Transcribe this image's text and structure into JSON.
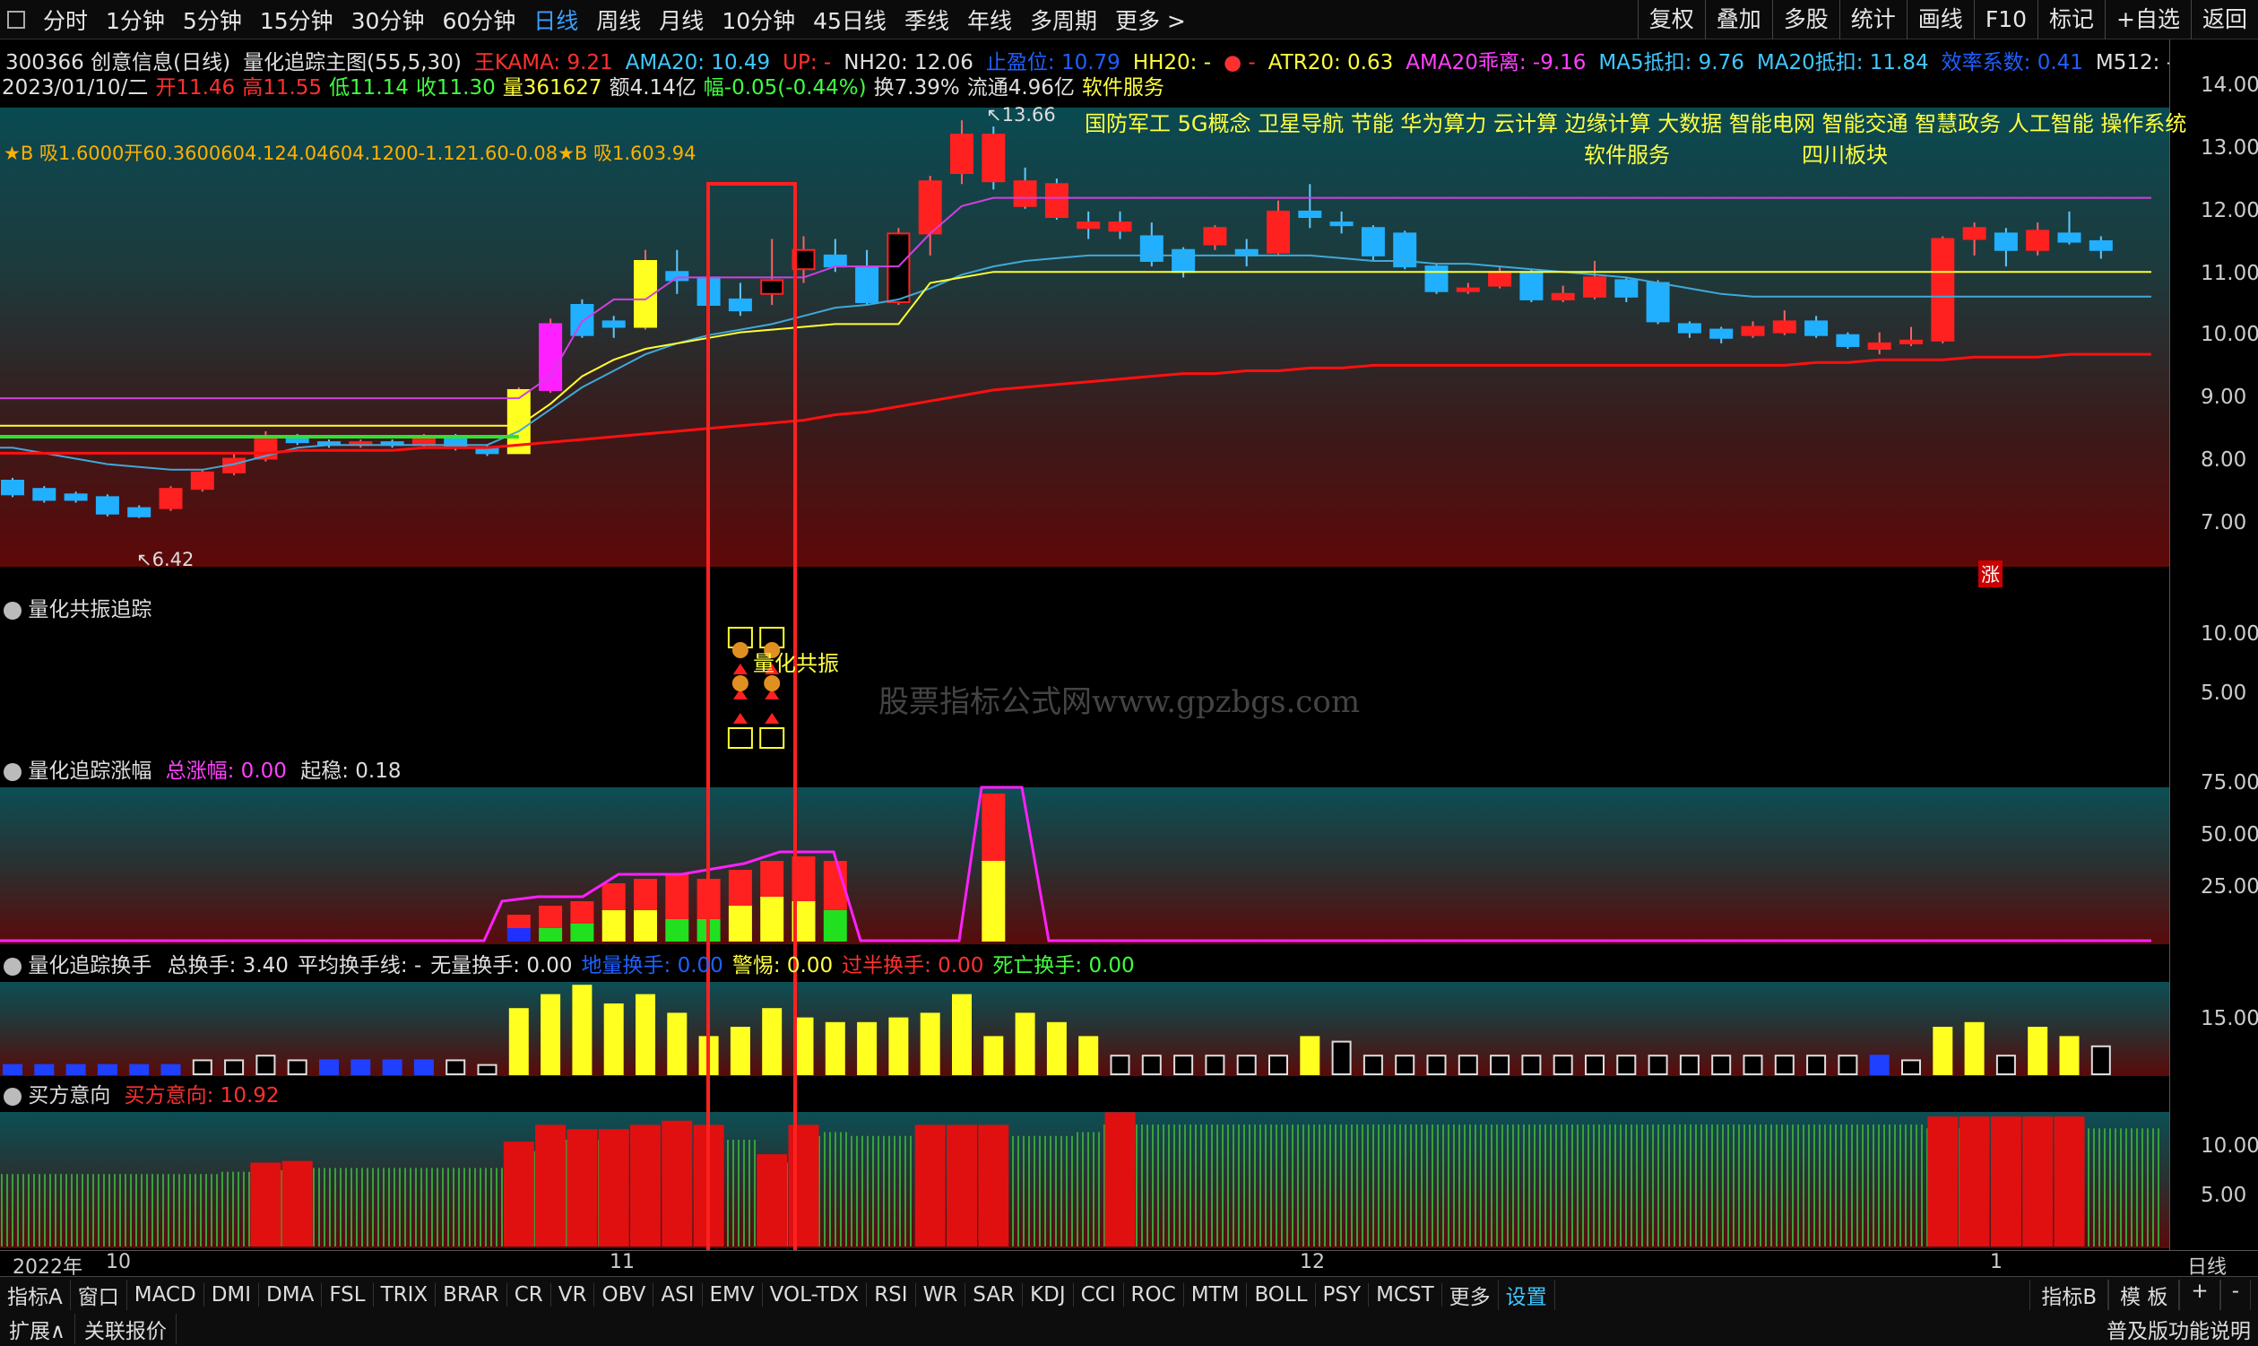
{
  "topbar": {
    "timeframes": [
      "分时",
      "1分钟",
      "5分钟",
      "15分钟",
      "30分钟",
      "60分钟",
      "日线",
      "周线",
      "月线",
      "10分钟",
      "45日线",
      "季线",
      "年线",
      "多周期",
      "更多 >"
    ],
    "active": "日线",
    "right": [
      "复权",
      "叠加",
      "多股",
      "统计",
      "画线",
      "F10",
      "标记",
      "+自选",
      "返回"
    ]
  },
  "info1": [
    {
      "t": "300366 创意信息(日线)",
      "c": "#e0e0e0"
    },
    {
      "t": "量化追踪主图(55,5,30)",
      "c": "#e0e0e0"
    },
    {
      "t": "王KAMA: 9.21",
      "c": "#ff3030"
    },
    {
      "t": "AMA20: 10.49",
      "c": "#40c8ff"
    },
    {
      "t": "UP: -",
      "c": "#ff3030"
    },
    {
      "t": "NH20: 12.06",
      "c": "#e0e0e0"
    },
    {
      "t": "止盈位: 10.79",
      "c": "#2060ff"
    },
    {
      "t": "HH20: -",
      "c": "#ffff40"
    },
    {
      "t": "● -",
      "c": "#ff3030"
    },
    {
      "t": "ATR20: 0.63",
      "c": "#ffff40"
    },
    {
      "t": "AMA20乖离: -9.16",
      "c": "#ff40ff"
    },
    {
      "t": "MA5抵扣: 9.76",
      "c": "#40c8ff"
    },
    {
      "t": "MA20抵扣: 11.84",
      "c": "#40c8ff"
    },
    {
      "t": "效率系数: 0.41",
      "c": "#2060ff"
    },
    {
      "t": "M512: -",
      "c": "#e0e0e0"
    },
    {
      "t": "M",
      "c": "#2060ff"
    }
  ],
  "info2": [
    {
      "t": "2023/01/10/二",
      "c": "#e0e0e0"
    },
    {
      "t": "开11.46",
      "c": "#ff3030"
    },
    {
      "t": "高11.55",
      "c": "#ff3030"
    },
    {
      "t": "低11.14",
      "c": "#40ff40"
    },
    {
      "t": "收11.30",
      "c": "#40ff40"
    },
    {
      "t": "量361627",
      "c": "#ffff40"
    },
    {
      "t": "额4.14亿",
      "c": "#e0e0e0"
    },
    {
      "t": "幅-0.05(-0.44%)",
      "c": "#40ff40"
    },
    {
      "t": "换7.39%",
      "c": "#e0e0e0"
    },
    {
      "t": "流通4.96亿",
      "c": "#e0e0e0"
    },
    {
      "t": "软件服务",
      "c": "#ffff40"
    }
  ],
  "main": {
    "annotation": "★B 吸1.6000开60.3600604.124.04604.1200-1.121.60-0.08★B 吸1.603.94",
    "concepts_line1": "国防军工 5G概念 卫星导航 节能 华为算力 云计算 边缘计算 大数据 智能电网 智能交通 智慧政务 人工智能 操作系统",
    "concepts_line2a": "软件服务",
    "concepts_line2b": "四川板块",
    "low_label": "6.42",
    "high_label": "13.66",
    "zhang": "涨"
  },
  "yaxis": {
    "main": [
      "14.00",
      "13.00",
      "12.00",
      "11.00",
      "10.00",
      "9.00",
      "8.00",
      "7.00"
    ],
    "p1": [
      "10.00",
      "5.00"
    ],
    "p2": [
      "75.00",
      "50.00",
      "25.00"
    ],
    "p3": [
      "15.00"
    ],
    "p4": [
      "10.00",
      "5.00"
    ]
  },
  "pane1": {
    "title": "量化共振追踪",
    "label": "量化共振",
    "watermark": "股票指标公式网www.gpzbgs.com"
  },
  "pane2": {
    "title": "量化追踪涨幅",
    "total": "总涨幅: 0.00",
    "start": "起稳: 0.18"
  },
  "pane3": {
    "title": "量化追踪换手",
    "items": [
      {
        "t": "总换手: 3.40",
        "c": "#e0e0e0"
      },
      {
        "t": "平均换手线: -",
        "c": "#e0e0e0"
      },
      {
        "t": "无量换手: 0.00",
        "c": "#e0e0e0"
      },
      {
        "t": "地量换手: 0.00",
        "c": "#2060ff"
      },
      {
        "t": "警惕: 0.00",
        "c": "#ffff40"
      },
      {
        "t": "过半换手: 0.00",
        "c": "#ff3030"
      },
      {
        "t": "死亡换手: 0.00",
        "c": "#40ff40"
      }
    ]
  },
  "pane4": {
    "title": "买方意向",
    "value": "买方意向: 10.92"
  },
  "xaxis": {
    "labels": [
      "2022年",
      "10",
      "11",
      "12",
      "1"
    ],
    "right": "日线"
  },
  "bottom1": [
    "指标A",
    "窗口",
    "MACD",
    "DMI",
    "DMA",
    "FSL",
    "TRIX",
    "BRAR",
    "CR",
    "VR",
    "OBV",
    "ASI",
    "EMV",
    "VOL-TDX",
    "RSI",
    "WR",
    "SAR",
    "KDJ",
    "CCI",
    "ROC",
    "MTM",
    "BOLL",
    "PSY",
    "MCST",
    "更多",
    "设置"
  ],
  "bottom1_right": [
    "指标B",
    "模 板",
    "+",
    "-"
  ],
  "bottom2": [
    "扩展∧",
    "关联报价"
  ],
  "bottom2_right": "普及版功能说明",
  "chart_data": {
    "type": "candlestick",
    "yrange": [
      6.3,
      14.3
    ],
    "candles": [
      {
        "o": 7.1,
        "c": 6.85,
        "h": 7.15,
        "l": 6.8
      },
      {
        "o": 6.95,
        "c": 6.75,
        "h": 7.0,
        "l": 6.7
      },
      {
        "o": 6.85,
        "c": 6.75,
        "h": 6.9,
        "l": 6.7
      },
      {
        "o": 6.8,
        "c": 6.5,
        "h": 6.85,
        "l": 6.45
      },
      {
        "o": 6.6,
        "c": 6.45,
        "h": 6.65,
        "l": 6.42
      },
      {
        "o": 6.6,
        "c": 6.95,
        "h": 7.0,
        "l": 6.55
      },
      {
        "o": 6.95,
        "c": 7.25,
        "h": 7.3,
        "l": 6.9
      },
      {
        "o": 7.25,
        "c": 7.5,
        "h": 7.6,
        "l": 7.2
      },
      {
        "o": 7.5,
        "c": 7.9,
        "h": 8.0,
        "l": 7.45
      },
      {
        "o": 7.9,
        "c": 7.8,
        "h": 7.95,
        "l": 7.75
      },
      {
        "o": 7.8,
        "c": 7.75,
        "h": 7.85,
        "l": 7.7
      },
      {
        "o": 7.75,
        "c": 7.8,
        "h": 7.85,
        "l": 7.7
      },
      {
        "o": 7.8,
        "c": 7.75,
        "h": 7.85,
        "l": 7.7
      },
      {
        "o": 7.75,
        "c": 7.9,
        "h": 7.95,
        "l": 7.7
      },
      {
        "o": 7.9,
        "c": 7.7,
        "h": 7.95,
        "l": 7.65
      },
      {
        "o": 7.7,
        "c": 7.6,
        "h": 7.75,
        "l": 7.55
      },
      {
        "o": 7.6,
        "c": 8.75,
        "h": 8.8,
        "l": 7.6
      },
      {
        "o": 8.75,
        "c": 9.95,
        "h": 10.05,
        "l": 8.7
      },
      {
        "o": 10.3,
        "c": 9.75,
        "h": 10.4,
        "l": 9.7
      },
      {
        "o": 10.0,
        "c": 9.9,
        "h": 10.1,
        "l": 9.7
      },
      {
        "o": 9.9,
        "c": 11.1,
        "h": 11.3,
        "l": 9.85
      },
      {
        "o": 10.9,
        "c": 10.75,
        "h": 11.3,
        "l": 10.5
      },
      {
        "o": 10.8,
        "c": 10.3,
        "h": 11.0,
        "l": 10.2
      },
      {
        "o": 10.4,
        "c": 10.2,
        "h": 10.7,
        "l": 10.1
      },
      {
        "o": 10.5,
        "c": 10.75,
        "h": 11.5,
        "l": 10.3
      },
      {
        "o": 10.95,
        "c": 11.3,
        "h": 11.55,
        "l": 10.7
      },
      {
        "o": 11.2,
        "c": 11.0,
        "h": 11.5,
        "l": 10.9
      },
      {
        "o": 11.0,
        "c": 10.35,
        "h": 11.3,
        "l": 10.3
      },
      {
        "o": 10.35,
        "c": 11.6,
        "h": 11.7,
        "l": 10.3
      },
      {
        "o": 11.6,
        "c": 12.55,
        "h": 12.65,
        "l": 11.2
      },
      {
        "o": 12.7,
        "c": 13.4,
        "h": 13.66,
        "l": 12.5
      },
      {
        "o": 13.4,
        "c": 12.55,
        "h": 13.55,
        "l": 12.4
      },
      {
        "o": 12.55,
        "c": 12.1,
        "h": 12.8,
        "l": 12.05
      },
      {
        "o": 12.5,
        "c": 11.9,
        "h": 12.6,
        "l": 11.85
      },
      {
        "o": 11.8,
        "c": 11.7,
        "h": 12.0,
        "l": 11.5
      },
      {
        "o": 11.8,
        "c": 11.65,
        "h": 12.0,
        "l": 11.5
      },
      {
        "o": 11.55,
        "c": 11.1,
        "h": 11.8,
        "l": 11.0
      },
      {
        "o": 11.3,
        "c": 10.9,
        "h": 11.35,
        "l": 10.8
      },
      {
        "o": 11.4,
        "c": 11.7,
        "h": 11.75,
        "l": 11.3
      },
      {
        "o": 11.3,
        "c": 11.2,
        "h": 11.5,
        "l": 11.0
      },
      {
        "o": 11.25,
        "c": 12.0,
        "h": 12.2,
        "l": 11.2
      },
      {
        "o": 12.0,
        "c": 11.9,
        "h": 12.5,
        "l": 11.7
      },
      {
        "o": 11.8,
        "c": 11.75,
        "h": 12.0,
        "l": 11.6
      },
      {
        "o": 11.7,
        "c": 11.2,
        "h": 11.75,
        "l": 11.1
      },
      {
        "o": 11.6,
        "c": 11.0,
        "h": 11.65,
        "l": 10.95
      },
      {
        "o": 11.0,
        "c": 10.55,
        "h": 11.05,
        "l": 10.5
      },
      {
        "o": 10.55,
        "c": 10.6,
        "h": 10.7,
        "l": 10.5
      },
      {
        "o": 10.65,
        "c": 10.9,
        "h": 11.0,
        "l": 10.6
      },
      {
        "o": 10.9,
        "c": 10.4,
        "h": 10.95,
        "l": 10.35
      },
      {
        "o": 10.4,
        "c": 10.5,
        "h": 10.65,
        "l": 10.35
      },
      {
        "o": 10.45,
        "c": 10.8,
        "h": 11.1,
        "l": 10.4
      },
      {
        "o": 10.75,
        "c": 10.45,
        "h": 10.8,
        "l": 10.35
      },
      {
        "o": 10.7,
        "c": 10.0,
        "h": 10.75,
        "l": 9.95
      },
      {
        "o": 9.95,
        "c": 9.8,
        "h": 10.0,
        "l": 9.7
      },
      {
        "o": 9.85,
        "c": 9.7,
        "h": 9.9,
        "l": 9.6
      },
      {
        "o": 9.75,
        "c": 9.9,
        "h": 10.0,
        "l": 9.7
      },
      {
        "o": 9.8,
        "c": 10.0,
        "h": 10.2,
        "l": 9.75
      },
      {
        "o": 10.0,
        "c": 9.75,
        "h": 10.1,
        "l": 9.7
      },
      {
        "o": 9.75,
        "c": 9.55,
        "h": 9.8,
        "l": 9.5
      },
      {
        "o": 9.5,
        "c": 9.6,
        "h": 9.8,
        "l": 9.4
      },
      {
        "o": 9.6,
        "c": 9.65,
        "h": 9.9,
        "l": 9.55
      },
      {
        "o": 9.65,
        "c": 11.5,
        "h": 11.55,
        "l": 9.6
      },
      {
        "o": 11.5,
        "c": 11.7,
        "h": 11.8,
        "l": 11.2
      },
      {
        "o": 11.6,
        "c": 11.3,
        "h": 11.7,
        "l": 11.0
      },
      {
        "o": 11.3,
        "c": 11.65,
        "h": 11.8,
        "l": 11.2
      },
      {
        "o": 11.6,
        "c": 11.45,
        "h": 12.0,
        "l": 11.4
      },
      {
        "o": 11.46,
        "c": 11.3,
        "h": 11.55,
        "l": 11.14
      }
    ],
    "ma_red": [
      7.6,
      7.6,
      7.6,
      7.6,
      7.6,
      7.6,
      7.6,
      7.6,
      7.6,
      7.65,
      7.65,
      7.65,
      7.65,
      7.7,
      7.7,
      7.7,
      7.75,
      7.8,
      7.85,
      7.9,
      7.95,
      8.0,
      8.05,
      8.1,
      8.15,
      8.2,
      8.3,
      8.35,
      8.45,
      8.55,
      8.65,
      8.75,
      8.8,
      8.85,
      8.9,
      8.95,
      9.0,
      9.05,
      9.05,
      9.1,
      9.1,
      9.15,
      9.15,
      9.2,
      9.2,
      9.2,
      9.2,
      9.2,
      9.2,
      9.2,
      9.2,
      9.2,
      9.2,
      9.2,
      9.2,
      9.2,
      9.2,
      9.25,
      9.25,
      9.3,
      9.3,
      9.3,
      9.35,
      9.35,
      9.35,
      9.4,
      9.4
    ],
    "ma_yellow": [
      8.1,
      8.1,
      8.1,
      8.1,
      8.1,
      8.1,
      8.1,
      8.1,
      8.1,
      8.1,
      8.1,
      8.1,
      8.1,
      8.1,
      8.1,
      8.1,
      8.1,
      8.5,
      9.0,
      9.3,
      9.5,
      9.6,
      9.7,
      9.8,
      9.85,
      9.9,
      9.95,
      9.95,
      9.95,
      10.7,
      10.8,
      10.9,
      10.9,
      10.9,
      10.9,
      10.9,
      10.9,
      10.9,
      10.9,
      10.9,
      10.9,
      10.9,
      10.9,
      10.9,
      10.9,
      10.9,
      10.9,
      10.9,
      10.9,
      10.9,
      10.9,
      10.9,
      10.9,
      10.9,
      10.9,
      10.9,
      10.9,
      10.9,
      10.9,
      10.9,
      10.9,
      10.9,
      10.9,
      10.9,
      10.9,
      10.9,
      10.9
    ],
    "ma_magenta": [
      8.6,
      8.6,
      8.6,
      8.6,
      8.6,
      8.6,
      8.6,
      8.6,
      8.6,
      8.6,
      8.6,
      8.6,
      8.6,
      8.6,
      8.6,
      8.6,
      8.6,
      9.0,
      10.0,
      10.4,
      10.4,
      10.8,
      10.8,
      10.8,
      10.8,
      10.8,
      11.0,
      11.0,
      11.0,
      11.6,
      12.1,
      12.25,
      12.25,
      12.25,
      12.25,
      12.25,
      12.25,
      12.25,
      12.25,
      12.25,
      12.25,
      12.25,
      12.25,
      12.25,
      12.25,
      12.25,
      12.25,
      12.25,
      12.25,
      12.25,
      12.25,
      12.25,
      12.25,
      12.25,
      12.25,
      12.25,
      12.25,
      12.25,
      12.25,
      12.25,
      12.25,
      12.25,
      12.25,
      12.25,
      12.25,
      12.25,
      12.25
    ],
    "ma_blue": [
      7.7,
      7.6,
      7.5,
      7.4,
      7.35,
      7.3,
      7.3,
      7.4,
      7.55,
      7.7,
      7.75,
      7.75,
      7.75,
      7.75,
      7.75,
      7.75,
      8.0,
      8.4,
      8.8,
      9.1,
      9.4,
      9.6,
      9.75,
      9.85,
      9.95,
      10.1,
      10.25,
      10.3,
      10.4,
      10.6,
      10.85,
      11.0,
      11.1,
      11.15,
      11.2,
      11.2,
      11.2,
      11.2,
      11.2,
      11.2,
      11.2,
      11.2,
      11.15,
      11.1,
      11.1,
      11.05,
      11.05,
      11.0,
      10.95,
      10.9,
      10.85,
      10.8,
      10.7,
      10.6,
      10.5,
      10.45,
      10.45,
      10.45,
      10.45,
      10.45,
      10.45,
      10.45,
      10.45,
      10.45,
      10.45,
      10.45,
      10.45
    ],
    "ma_green_level": 7.9,
    "turnover": [
      2,
      2,
      2,
      2,
      2,
      2,
      3,
      3,
      4,
      3,
      3,
      3,
      3,
      3,
      3,
      2,
      14,
      17,
      19,
      15,
      17,
      13,
      8,
      10,
      14,
      12,
      11,
      11,
      12,
      13,
      17,
      8,
      13,
      11,
      8,
      4,
      4,
      4,
      4,
      4,
      4,
      8,
      7,
      4,
      4,
      4,
      4,
      4,
      4,
      4,
      4,
      4,
      4,
      4,
      4,
      4,
      4,
      4,
      4,
      4,
      3,
      10,
      11,
      4,
      10,
      8,
      6
    ],
    "buy_intent": [
      9.5,
      9.5,
      9.5,
      9.5,
      9.5,
      9.5,
      9.5,
      9.8,
      10.0,
      10.2,
      10.3,
      10.3,
      10.3,
      10.3,
      10.3,
      10.3,
      12.5,
      14.5,
      14,
      14,
      14.5,
      15,
      14.5,
      14,
      11,
      14.5,
      15,
      14.5,
      14.5,
      14.5,
      14.5,
      14.5,
      14.5,
      14.5,
      15,
      16,
      16,
      16,
      16,
      16,
      16,
      16,
      16,
      16,
      16,
      16,
      16,
      16,
      16,
      16,
      16,
      16,
      16,
      16,
      16,
      16,
      16,
      16,
      16,
      16,
      16,
      15.5,
      15.5,
      15.5,
      15.5,
      15.5,
      15.5
    ]
  }
}
